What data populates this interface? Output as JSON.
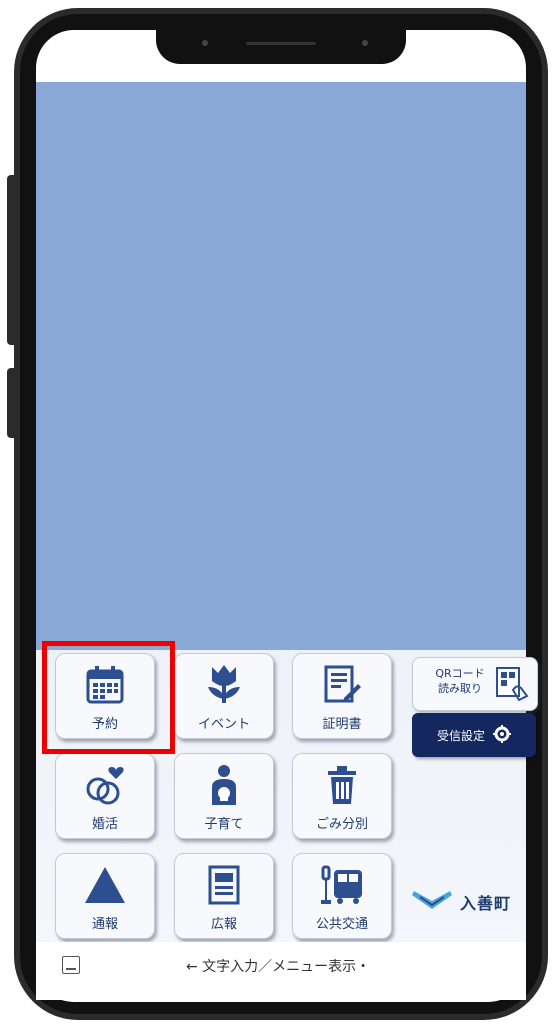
{
  "menu": {
    "row1": [
      {
        "label": "予約",
        "icon": "calendar-icon"
      },
      {
        "label": "イベント",
        "icon": "tulip-icon"
      },
      {
        "label": "証明書",
        "icon": "certificate-icon"
      }
    ],
    "row2": [
      {
        "label": "婚活",
        "icon": "rings-heart-icon"
      },
      {
        "label": "子育て",
        "icon": "parent-child-icon"
      },
      {
        "label": "ごみ分別",
        "icon": "trash-icon"
      }
    ],
    "row3": [
      {
        "label": "通報",
        "icon": "warning-icon"
      },
      {
        "label": "広報",
        "icon": "newsletter-icon"
      },
      {
        "label": "公共交通",
        "icon": "bus-stop-icon"
      }
    ],
    "qr": {
      "line1": "QRコード",
      "line2": "読み取り"
    },
    "settings_label": "受信設定",
    "town_name": "入善町"
  },
  "input_bar": {
    "text": "← 文字入力／メニュー表示・"
  },
  "colors": {
    "chat_bg": "#8aa9d6",
    "accent_navy": "#14275e",
    "icon_blue": "#2e4f8f",
    "highlight": "#ee0000"
  }
}
